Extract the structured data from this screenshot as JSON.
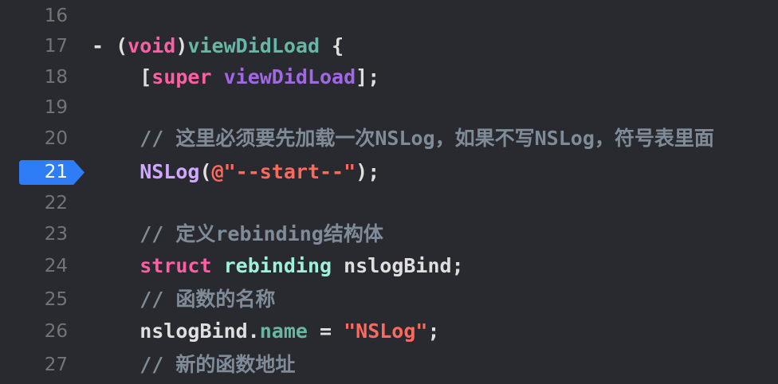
{
  "editor": {
    "lines": [
      {
        "num": "16",
        "segments": []
      },
      {
        "num": "17",
        "segments": [
          {
            "cls": "plain",
            "text": "- ("
          },
          {
            "cls": "kw",
            "text": "void"
          },
          {
            "cls": "plain",
            "text": ")"
          },
          {
            "cls": "fn",
            "text": "viewDidLoad"
          },
          {
            "cls": "plain",
            "text": " {"
          }
        ]
      },
      {
        "num": "18",
        "segments": [
          {
            "cls": "plain",
            "text": "    ["
          },
          {
            "cls": "kw",
            "text": "super"
          },
          {
            "cls": "plain",
            "text": " "
          },
          {
            "cls": "sup",
            "text": "viewDidLoad"
          },
          {
            "cls": "plain",
            "text": "];"
          }
        ]
      },
      {
        "num": "19",
        "segments": []
      },
      {
        "num": "20",
        "segments": [
          {
            "cls": "cmt",
            "text": "    // 这里必须要先加载一次NSLog，如果不写NSLog，符号表里面"
          }
        ]
      },
      {
        "num": "21",
        "breakpoint": true,
        "segments": [
          {
            "cls": "plain",
            "text": "    "
          },
          {
            "cls": "cls",
            "text": "NSLog"
          },
          {
            "cls": "plain",
            "text": "("
          },
          {
            "cls": "str",
            "text": "@\"--start--\""
          },
          {
            "cls": "plain",
            "text": ");"
          }
        ]
      },
      {
        "num": "22",
        "segments": []
      },
      {
        "num": "23",
        "segments": [
          {
            "cls": "cmt",
            "text": "    // 定义rebinding结构体"
          }
        ]
      },
      {
        "num": "24",
        "segments": [
          {
            "cls": "plain",
            "text": "    "
          },
          {
            "cls": "kw",
            "text": "struct"
          },
          {
            "cls": "plain",
            "text": " "
          },
          {
            "cls": "ty",
            "text": "rebinding"
          },
          {
            "cls": "plain",
            "text": " nslogBind;"
          }
        ]
      },
      {
        "num": "25",
        "segments": [
          {
            "cls": "cmt",
            "text": "    // 函数的名称"
          }
        ]
      },
      {
        "num": "26",
        "segments": [
          {
            "cls": "plain",
            "text": "    nslogBind."
          },
          {
            "cls": "prop",
            "text": "name"
          },
          {
            "cls": "plain",
            "text": " = "
          },
          {
            "cls": "str",
            "text": "\"NSLog\""
          },
          {
            "cls": "plain",
            "text": ";"
          }
        ]
      },
      {
        "num": "27",
        "segments": [
          {
            "cls": "cmt",
            "text": "    // 新的函数地址"
          }
        ]
      }
    ],
    "colors": {
      "background": "#292a30",
      "breakpoint": "#2f7df6",
      "keyword": "#fc5fa3",
      "string": "#fc6a5d",
      "comment": "#7f8c98",
      "function": "#67b7a4",
      "class": "#d0a8ff",
      "line_number": "#747478"
    },
    "icons": {
      "breakpoint": "breakpoint-arrow-icon"
    }
  }
}
